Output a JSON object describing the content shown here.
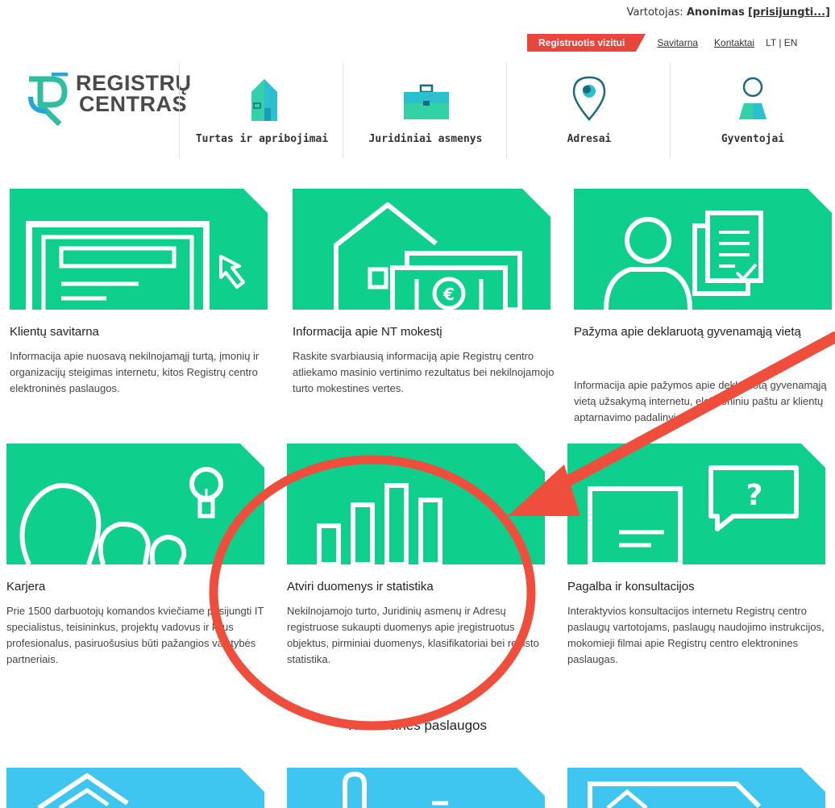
{
  "user": {
    "label": "Vartotojas:",
    "name": "Anonimas",
    "login": "[prisijungti...]"
  },
  "topnav": {
    "register": "Registruotis vizitui",
    "selfservice": "Savitarna",
    "contacts": "Kontaktai",
    "lang": "LT | EN"
  },
  "logo": {
    "line1": "REGISTRŲ",
    "line2": "CENTRAS",
    "brand_color": "#2fbfa0"
  },
  "categories": [
    {
      "label": "Turtas ir apribojimai",
      "icon": "house-icon"
    },
    {
      "label": "Juridiniai asmenys",
      "icon": "briefcase-icon"
    },
    {
      "label": "Adresai",
      "icon": "map-pin-icon"
    },
    {
      "label": "Gyventojai",
      "icon": "person-icon"
    }
  ],
  "cards": [
    {
      "title": "Klientų savitarna",
      "text": "Informacija apie nuosavą nekilnojamąjį turtą, įmonių ir organizacijų steigimas internetu, kitos Registrų centro elektroninės paslaugos.",
      "icon": "window-cursor-icon"
    },
    {
      "title": "Informacija apie NT mokestį",
      "text": "Raskite svarbiausią informaciją apie Registrų centro atliekamo masinio vertinimo rezultatus bei nekilnojamojo turto mokestines vertes.",
      "icon": "house-money-icon"
    },
    {
      "title": "Pažyma apie deklaruotą gyvenamąją vietą",
      "text": "Informacija apie pažymos apie deklaruotą gyvenamąją vietą užsakymą internetu, elektroniniu paštu ar klientų aptarnavimo padalinyje.",
      "icon": "person-document-icon"
    },
    {
      "title": "Karjera",
      "text": "Prie 1500 darbuotojų komandos kviečiame prisijungti IT specialistus, teisininkus, projektų vadovus ir kitus profesionalus, pasiruošusius būti pažangios valstybės partneriais.",
      "icon": "people-idea-icon"
    },
    {
      "title": "Atviri duomenys ir statistika",
      "text": "Nekilnojamojo turto, Juridinių asmenų ir Adresų registruose sukaupti duomenys apie įregistruotus objektus, pirminiai duomenys, klasifikatoriai bei registo statistika.",
      "icon": "bar-chart-icon"
    },
    {
      "title": "Pagalba ir konsultacijos",
      "text": "Interaktyvios konsultacijos internetu Registrų centro paslaugų vartotojams, paslaugų naudojimo instrukcijos, mokomieji filmai apie Registrų centro elektronines paslaugas.",
      "icon": "chat-question-icon"
    }
  ],
  "commercial_title": "Komercinės paslaugos",
  "colors": {
    "tile_green": "#0fcf8d",
    "tile_blue": "#3fc6f0",
    "accent_red": "#e8453c",
    "annotation_red": "#ef4e3c"
  }
}
